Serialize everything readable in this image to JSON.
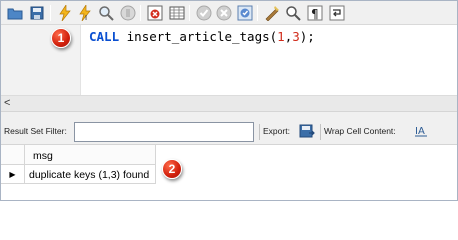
{
  "toolbar": {
    "icons": [
      "open-icon",
      "save-icon",
      "execute-icon",
      "execute-current-icon",
      "explain-icon",
      "stop-icon",
      "toggle-results-icon",
      "grid-icon",
      "commit-icon",
      "rollback-icon",
      "autocommit-icon",
      "beautify-icon",
      "find-icon",
      "invisible-chars-icon",
      "wrap-icon"
    ]
  },
  "editor": {
    "badge_1": "1",
    "code": {
      "keyword": "CALL",
      "proc": "insert_article_tags",
      "open_paren": "(",
      "arg1": "1",
      "comma": ",",
      "arg2": "3",
      "close": ");"
    }
  },
  "scrollbar": {
    "left_arrow": "<"
  },
  "filterbar": {
    "result_filter_label": "Result Set Filter:",
    "result_filter_value": "",
    "export_label": "Export:",
    "wrap_label": "Wrap Cell Content:"
  },
  "grid": {
    "columns": [
      "msg"
    ],
    "rows": [
      [
        "duplicate keys (1,3) found"
      ]
    ],
    "row_marker": "▶",
    "badge_2": "2"
  },
  "colors": {
    "keyword": "#0a4fd1",
    "number": "#d12b1b",
    "badge": "#d1200c"
  }
}
